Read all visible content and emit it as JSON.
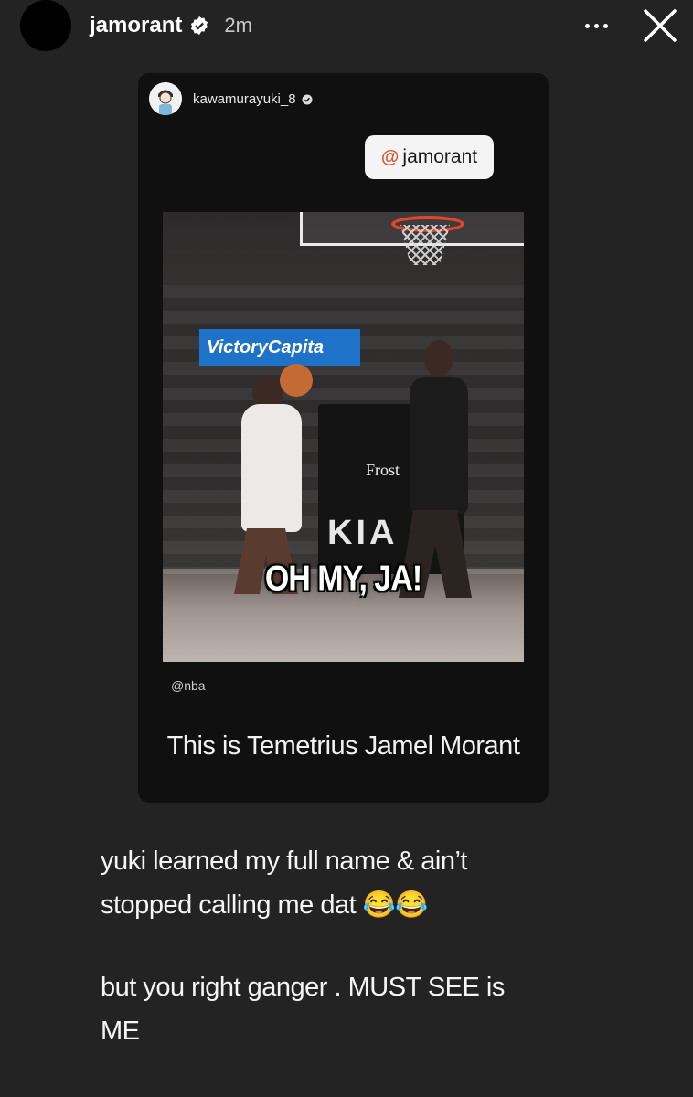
{
  "header": {
    "username": "jamorant",
    "time": "2m",
    "verified_icon": "verified-badge-icon",
    "more_icon": "more-dots-icon",
    "close_icon": "close-icon"
  },
  "shared_post": {
    "username": "kawamurayuki_8",
    "mention": "@jamorant",
    "mention_prefix": "@",
    "mention_name": "jamorant",
    "video": {
      "sponsor": "VictoryCapita",
      "stanchion": "Frost",
      "court_logo": "KIA",
      "caption": "OH MY, JA!"
    },
    "credit": "@nba",
    "text": "This is Temetrius Jamel Morant"
  },
  "story": {
    "line1": "yuki learned my full name & ain’t",
    "line2": "stopped calling me dat 😂😂",
    "line3": "but you right ganger . MUST SEE is",
    "line4": "ME"
  },
  "colors": {
    "background": "#232323",
    "card": "#101010",
    "accent": "#e0572e"
  }
}
